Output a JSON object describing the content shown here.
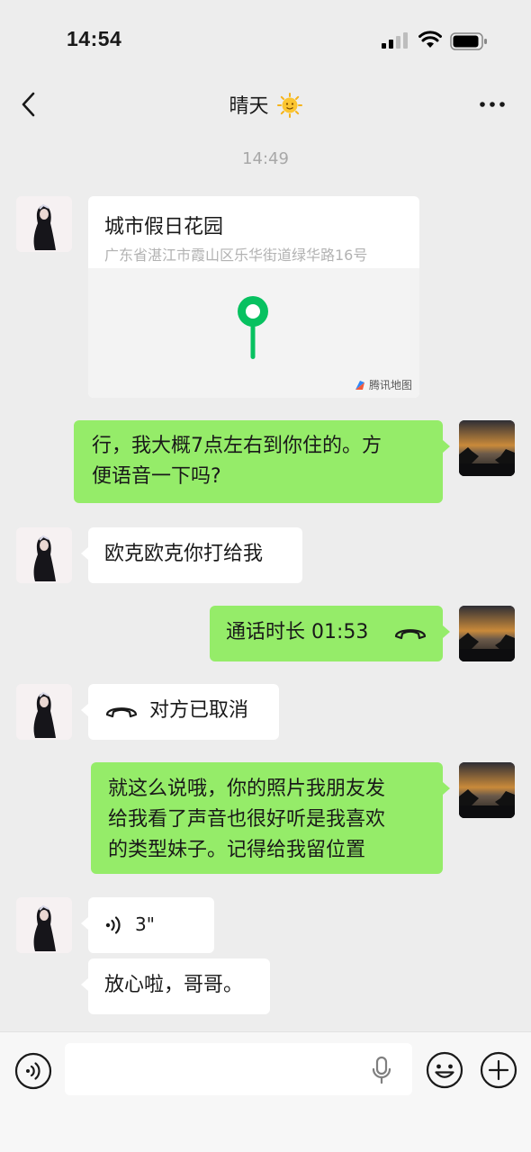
{
  "status": {
    "time": "14:54"
  },
  "header": {
    "title": "晴天"
  },
  "chat": {
    "timestamp": "14:49",
    "location": {
      "name": "城市假日花园",
      "address": "广东省湛江市霞山区乐华街道绿华路16号",
      "map_brand": "腾讯地图"
    },
    "msg_sent_1": {
      "line1": "行，我大概7点左右到你住的。方",
      "line2": "便语音一下吗?"
    },
    "msg_recv_1": "欧克欧克你打给我",
    "call_sent": "通话时长 01:53",
    "call_recv": "对方已取消",
    "msg_sent_2": {
      "line1": "就这么说哦，你的照片我朋友发",
      "line2": "给我看了声音也很好听是我喜欢",
      "line3": "的类型妹子。记得给我留位置"
    },
    "voice_recv": "3\"",
    "msg_recv_2": "放心啦，哥哥。"
  },
  "colors": {
    "sent_bubble": "#95ec69",
    "received_bubble": "#ffffff",
    "background": "#ededed",
    "pin": "#07c160"
  },
  "icons": [
    "back-icon",
    "more-icon",
    "map-pin-icon",
    "phone-hangup-icon",
    "voice-wave-icon",
    "mic-icon",
    "emoji-icon",
    "plus-icon",
    "voice-toggle-icon"
  ]
}
